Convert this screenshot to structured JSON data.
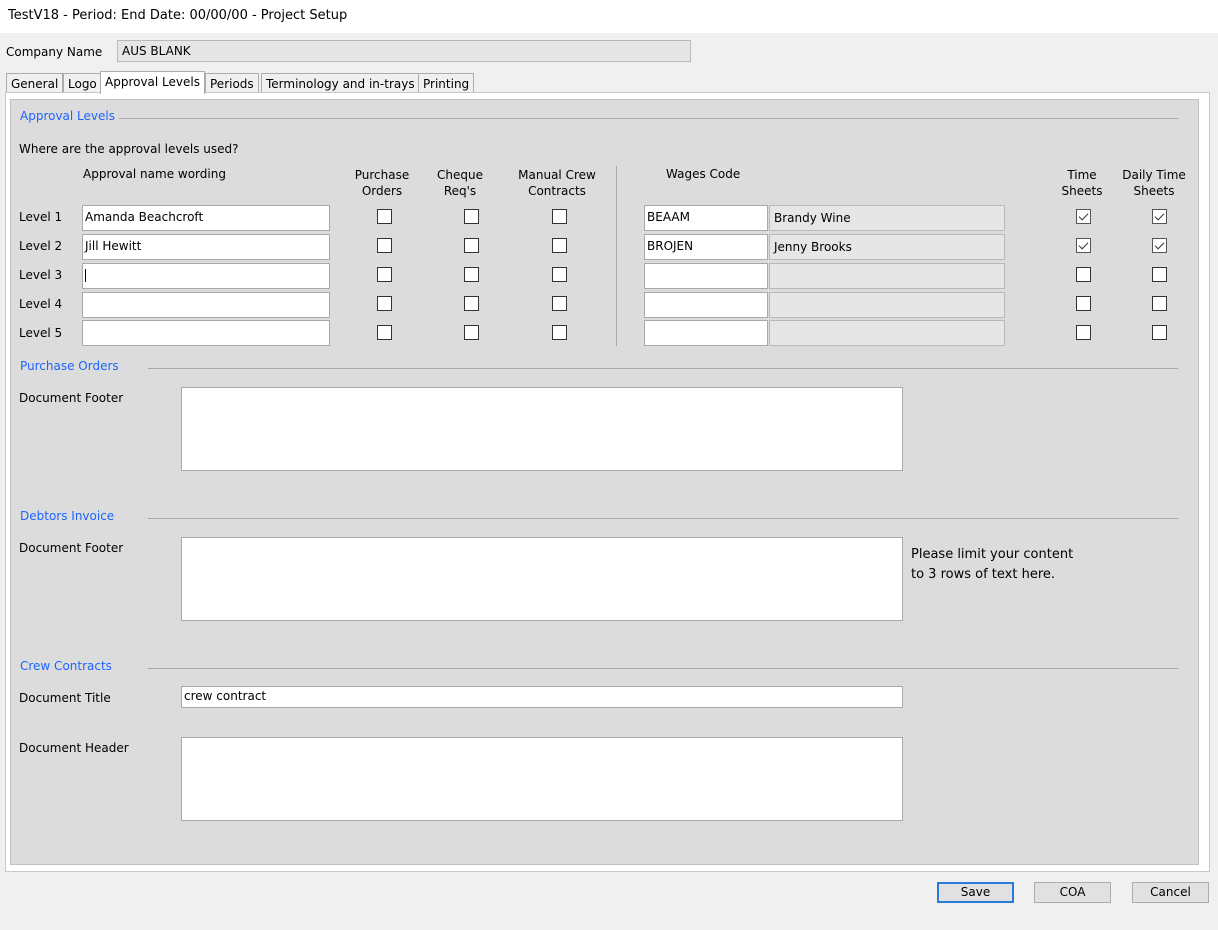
{
  "window": {
    "title": "TestV18  - Period:  End Date: 00/00/00 - Project Setup"
  },
  "company": {
    "label": "Company Name",
    "value": "AUS BLANK"
  },
  "tabs": [
    {
      "label": "General"
    },
    {
      "label": "Logo"
    },
    {
      "label": "Approval Levels"
    },
    {
      "label": "Periods"
    },
    {
      "label": "Terminology and in-trays"
    },
    {
      "label": "Printing"
    }
  ],
  "approval": {
    "section_title": "Approval Levels",
    "question": "Where are the approval levels used?",
    "headers": {
      "name": "Approval name wording",
      "po_line1": "Purchase",
      "po_line2": "Orders",
      "cheque_line1": "Cheque",
      "cheque_line2": "Req's",
      "crew_line1": "Manual Crew",
      "crew_line2": "Contracts",
      "wages": "Wages Code",
      "time_line1": "Time",
      "time_line2": "Sheets",
      "daily_line1": "Daily Time",
      "daily_line2": "Sheets"
    },
    "levels": [
      {
        "label": "Level 1",
        "name": "Amanda Beachcroft",
        "po": false,
        "cheque": false,
        "crew": false,
        "wages_code": "BEAAM",
        "wages_name": "Brandy Wine",
        "time": true,
        "daily": true
      },
      {
        "label": "Level 2",
        "name": "Jill Hewitt",
        "po": false,
        "cheque": false,
        "crew": false,
        "wages_code": "BROJEN",
        "wages_name": "Jenny Brooks",
        "time": true,
        "daily": true
      },
      {
        "label": "Level 3",
        "name": "",
        "po": false,
        "cheque": false,
        "crew": false,
        "wages_code": "",
        "wages_name": "",
        "time": false,
        "daily": false
      },
      {
        "label": "Level 4",
        "name": "",
        "po": false,
        "cheque": false,
        "crew": false,
        "wages_code": "",
        "wages_name": "",
        "time": false,
        "daily": false
      },
      {
        "label": "Level 5",
        "name": "",
        "po": false,
        "cheque": false,
        "crew": false,
        "wages_code": "",
        "wages_name": "",
        "time": false,
        "daily": false
      }
    ]
  },
  "purchase_orders": {
    "section_title": "Purchase Orders",
    "footer_label": "Document Footer",
    "footer_value": ""
  },
  "debtors_invoice": {
    "section_title": "Debtors Invoice",
    "footer_label": "Document Footer",
    "footer_value": "",
    "hint_line1": "Please limit your content",
    "hint_line2": "to 3 rows of text here."
  },
  "crew_contracts": {
    "section_title": "Crew Contracts",
    "title_label": "Document Title",
    "title_value": "crew contract",
    "header_label": "Document Header",
    "header_value": ""
  },
  "buttons": {
    "save": "Save",
    "coa": "COA",
    "cancel": "Cancel"
  },
  "colors": {
    "section_title": "#1e64ff",
    "panel_bg": "#dcdcdc",
    "default_button_border": "#2b7bd8"
  }
}
